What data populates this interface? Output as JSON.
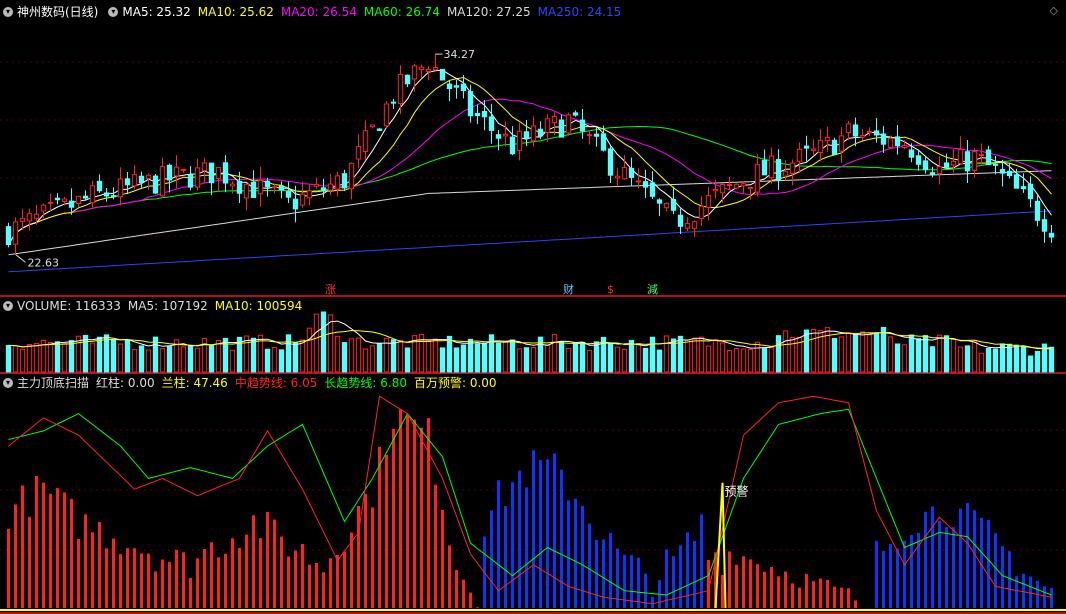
{
  "main": {
    "stock": "神州数码(日线)",
    "ma_labels": [
      {
        "text": "MA5: 25.32",
        "color": "#ffffff"
      },
      {
        "text": "MA10: 25.62",
        "color": "#ffff00"
      },
      {
        "text": "MA20: 26.54",
        "color": "#ff00ff"
      },
      {
        "text": "MA60: 26.74",
        "color": "#00ff00"
      },
      {
        "text": "MA120: 27.25",
        "color": "#d8d8d8"
      },
      {
        "text": "MA250: 24.15",
        "color": "#2a44ff"
      }
    ],
    "high_label": "34.27",
    "low_label": "22.63",
    "markers": [
      {
        "text": "涨",
        "color": "#ff3333",
        "x_index": 46
      },
      {
        "text": "财",
        "color": "#55ccff",
        "x_index": 80
      },
      {
        "text": "$",
        "color": "#ff3333",
        "x_index": 86
      },
      {
        "text": "減",
        "color": "#44ff66",
        "x_index": 92
      }
    ]
  },
  "volume_panel": {
    "labels": [
      {
        "text": "VOLUME: 116333",
        "color": "#dddddd"
      },
      {
        "text": "MA5: 107192",
        "color": "#dddddd"
      },
      {
        "text": "MA10: 100594",
        "color": "#ffff00"
      }
    ]
  },
  "indicator_panel": {
    "labels": [
      {
        "text": "主力顶底扫描",
        "color": "#dddddd"
      },
      {
        "text": "红柱: 0.00",
        "color": "#dddddd"
      },
      {
        "text": "兰柱: 47.46",
        "color": "#ffff00"
      },
      {
        "text": "中趋势线: 6.05",
        "color": "#ff2222"
      },
      {
        "text": "长趋势线: 6.80",
        "color": "#00ff00"
      },
      {
        "text": "百万预警: 0.00",
        "color": "#ffff00"
      }
    ],
    "warning_label": "预警"
  },
  "colors": {
    "up": "#ff2222",
    "down": "#54ffff",
    "divider": "#b01020",
    "grid": "#5a0000"
  },
  "chart_data": {
    "type": "candlestick",
    "count": 150,
    "ylim": [
      20.0,
      35.5
    ],
    "candles": [],
    "volume": [],
    "indicator": {
      "ylim": [
        0,
        100
      ]
    }
  }
}
